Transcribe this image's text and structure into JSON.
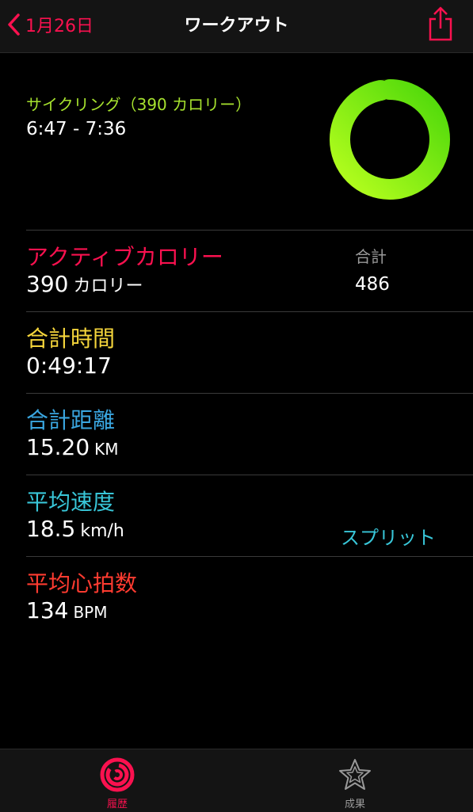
{
  "nav": {
    "back_label": "1月26日",
    "title": "ワークアウト"
  },
  "summary": {
    "workout_title": "サイクリング（390 カロリー）",
    "time_range": "6:47 - 7:36",
    "ring_progress": 0.97,
    "ring_color": "#8ce000"
  },
  "metrics": {
    "active_calories": {
      "label": "アクティブカロリー",
      "value": "390",
      "unit": "カロリー",
      "total_label": "合計",
      "total_value": "486",
      "color": "#fa114f"
    },
    "total_time": {
      "label": "合計時間",
      "value": "0:49:17",
      "color": "#f5d53b"
    },
    "total_distance": {
      "label": "合計距離",
      "value": "15.20",
      "unit": "KM",
      "color": "#3aa6e0"
    },
    "avg_speed": {
      "label": "平均速度",
      "value": "18.5",
      "unit": "km/h",
      "split_label": "スプリット",
      "color": "#38c6d8"
    },
    "avg_heart_rate": {
      "label": "平均心拍数",
      "value": "134",
      "unit": "BPM",
      "color": "#ff3b30"
    }
  },
  "tabbar": {
    "tabs": [
      {
        "label": "履歴",
        "icon": "history-rings-icon",
        "active": true
      },
      {
        "label": "成果",
        "icon": "star-icon",
        "active": false
      }
    ]
  }
}
